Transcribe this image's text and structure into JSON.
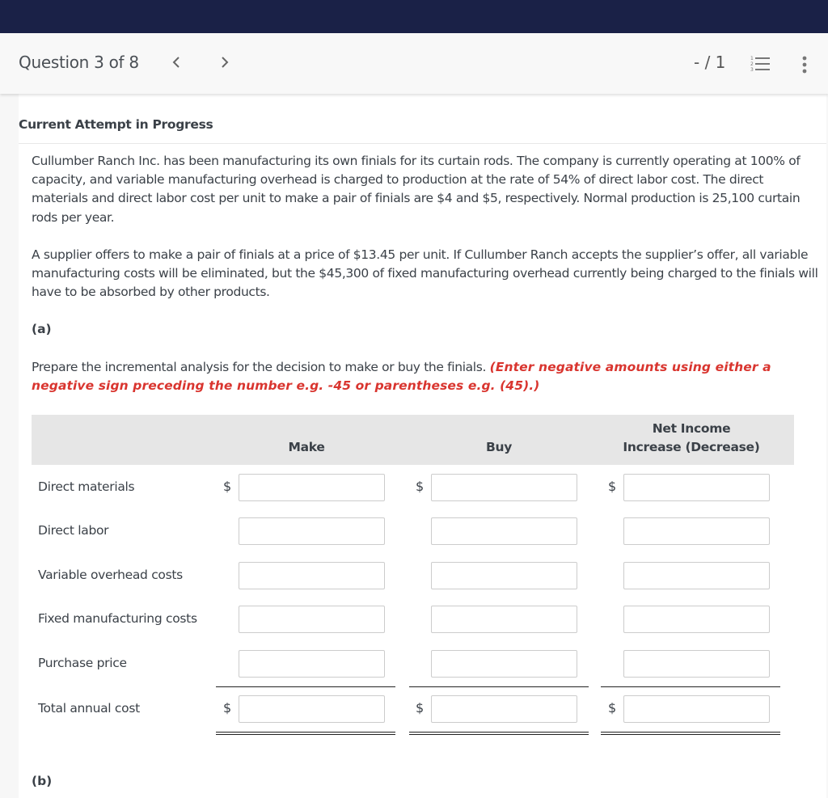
{
  "header": {
    "question_position": "Question 3 of 8",
    "score": "- / 1",
    "icons": {
      "prev": "chevron-left-icon",
      "next": "chevron-right-icon",
      "question_list": "numbered-list-icon",
      "more": "more-vertical-icon"
    }
  },
  "attempt_title": "Current Attempt in Progress",
  "problem": {
    "paragraph_1": "Cullumber Ranch Inc. has been manufacturing its own finials for its curtain rods. The company is currently operating at 100% of capacity, and variable manufacturing overhead is charged to production at the rate of 54% of direct labor cost. The direct materials and direct labor cost per unit to make a pair of finials are $4 and $5, respectively. Normal production is 25,100 curtain rods per year.",
    "paragraph_2": "A supplier offers to make a pair of finials at a price of $13.45 per unit. If Cullumber Ranch accepts the supplier’s offer, all variable manufacturing costs will be eliminated, but the $45,300 of fixed manufacturing overhead currently being charged to the finials will have to be absorbed by other products."
  },
  "part_a": {
    "label": "(a)",
    "prompt": "Prepare the incremental analysis for the decision to make or buy the finials. ",
    "instruction": "(Enter negative amounts using either a negative sign preceding the number e.g. -45 or parentheses e.g. (45).)",
    "accent_color": "#d9352f",
    "table": {
      "columns": [
        "Make",
        "Buy",
        "Net Income\nIncrease (Decrease)"
      ],
      "column_make": "Make",
      "column_buy": "Buy",
      "column_net_line1": "Net Income",
      "column_net_line2": "Increase (Decrease)",
      "currency_symbol": "$",
      "rows": [
        {
          "label": "Direct materials",
          "make": "",
          "buy": "",
          "net": ""
        },
        {
          "label": "Direct labor",
          "make": "",
          "buy": "",
          "net": ""
        },
        {
          "label": "Variable overhead costs",
          "make": "",
          "buy": "",
          "net": ""
        },
        {
          "label": "Fixed manufacturing costs",
          "make": "",
          "buy": "",
          "net": ""
        },
        {
          "label": "Purchase price",
          "make": "",
          "buy": "",
          "net": ""
        },
        {
          "label": "Total annual cost",
          "make": "",
          "buy": "",
          "net": ""
        }
      ]
    }
  },
  "part_b": {
    "label": "(b)"
  }
}
